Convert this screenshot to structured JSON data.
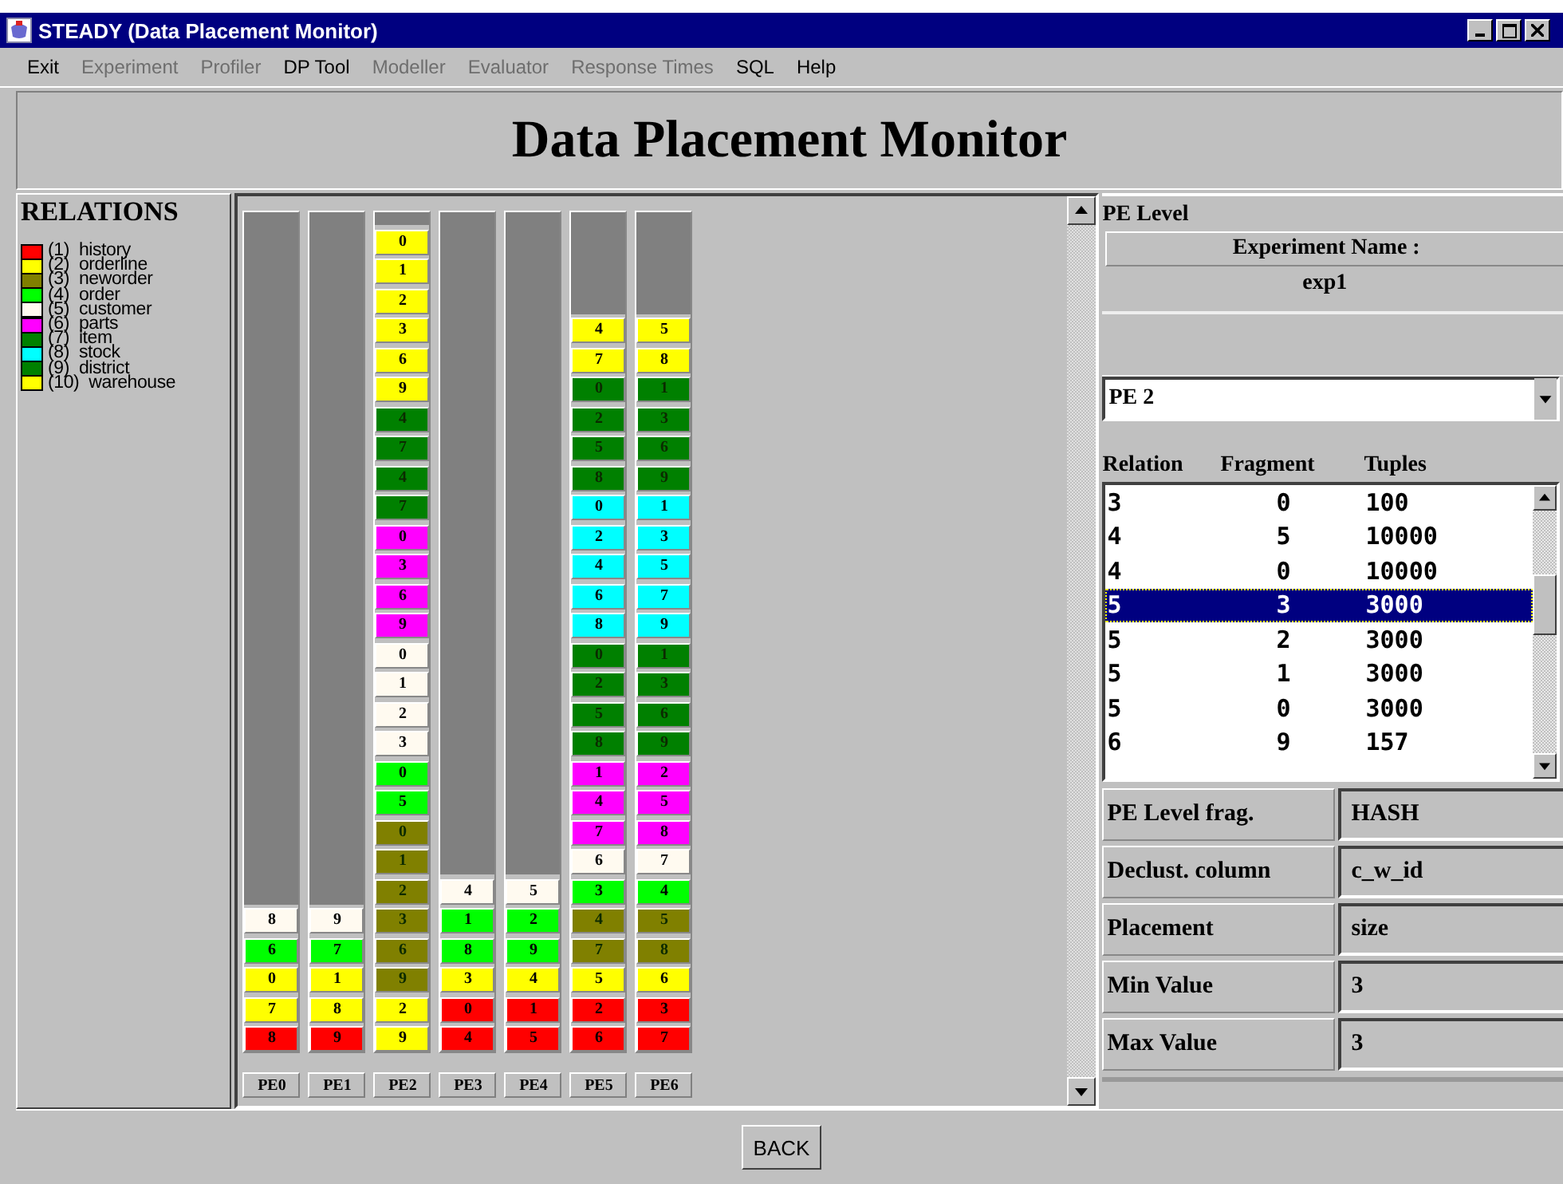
{
  "window": {
    "title": "STEADY (Data Placement Monitor)"
  },
  "menu": [
    {
      "label": "Exit",
      "disabled": false
    },
    {
      "label": "Experiment",
      "disabled": true
    },
    {
      "label": "Profiler",
      "disabled": true
    },
    {
      "label": "DP Tool",
      "disabled": false
    },
    {
      "label": "Modeller",
      "disabled": true
    },
    {
      "label": "Evaluator",
      "disabled": true
    },
    {
      "label": "Response Times",
      "disabled": true
    },
    {
      "label": "SQL",
      "disabled": false
    },
    {
      "label": "Help",
      "disabled": false
    }
  ],
  "heading": "Data Placement Monitor",
  "legend": {
    "title": "RELATIONS",
    "items": [
      {
        "label": "(1)  history",
        "color": "#ff0000"
      },
      {
        "label": "(2)  orderline",
        "color": "#ffff00"
      },
      {
        "label": "(3)  neworder",
        "color": "#808000"
      },
      {
        "label": "(4)  order",
        "color": "#00ff00"
      },
      {
        "label": "(5)  customer",
        "color": "#fffaf0"
      },
      {
        "label": "(6)  parts",
        "color": "#ff00ff"
      },
      {
        "label": "(7)  item",
        "color": "#008000"
      },
      {
        "label": "(8)  stock",
        "color": "#00ffff"
      },
      {
        "label": "(9)  district",
        "color": "#008000"
      },
      {
        "label": "(10)  warehouse",
        "color": "#ffff00"
      }
    ]
  },
  "pes": [
    {
      "label": "PE0",
      "fragments": [
        {
          "label": "8",
          "color": "#fffaf0"
        },
        {
          "label": "6",
          "color": "#00ff00"
        },
        {
          "label": "0",
          "color": "#ffff00"
        },
        {
          "label": "7",
          "color": "#ffff00"
        },
        {
          "label": "8",
          "color": "#ff0000"
        }
      ]
    },
    {
      "label": "PE1",
      "fragments": [
        {
          "label": "9",
          "color": "#fffaf0"
        },
        {
          "label": "7",
          "color": "#00ff00"
        },
        {
          "label": "1",
          "color": "#ffff00"
        },
        {
          "label": "8",
          "color": "#ffff00"
        },
        {
          "label": "9",
          "color": "#ff0000"
        }
      ]
    },
    {
      "label": "PE2",
      "fragments": [
        {
          "label": "0",
          "color": "#ffff00"
        },
        {
          "label": "1",
          "color": "#ffff00"
        },
        {
          "label": "2",
          "color": "#ffff00"
        },
        {
          "label": "3",
          "color": "#ffff00"
        },
        {
          "label": "6",
          "color": "#ffff00"
        },
        {
          "label": "9",
          "color": "#ffff00"
        },
        {
          "label": "4",
          "color": "#008000"
        },
        {
          "label": "7",
          "color": "#008000"
        },
        {
          "label": "4",
          "color": "#008000"
        },
        {
          "label": "7",
          "color": "#008000"
        },
        {
          "label": "0",
          "color": "#ff00ff"
        },
        {
          "label": "3",
          "color": "#ff00ff"
        },
        {
          "label": "6",
          "color": "#ff00ff"
        },
        {
          "label": "9",
          "color": "#ff00ff"
        },
        {
          "label": "0",
          "color": "#fffaf0"
        },
        {
          "label": "1",
          "color": "#fffaf0"
        },
        {
          "label": "2",
          "color": "#fffaf0"
        },
        {
          "label": "3",
          "color": "#fffaf0"
        },
        {
          "label": "0",
          "color": "#00ff00"
        },
        {
          "label": "5",
          "color": "#00ff00"
        },
        {
          "label": "0",
          "color": "#808000"
        },
        {
          "label": "1",
          "color": "#808000"
        },
        {
          "label": "2",
          "color": "#808000"
        },
        {
          "label": "3",
          "color": "#808000"
        },
        {
          "label": "6",
          "color": "#808000"
        },
        {
          "label": "9",
          "color": "#808000"
        },
        {
          "label": "2",
          "color": "#ffff00"
        },
        {
          "label": "9",
          "color": "#ffff00"
        }
      ]
    },
    {
      "label": "PE3",
      "fragments": [
        {
          "label": "4",
          "color": "#fffaf0"
        },
        {
          "label": "1",
          "color": "#00ff00"
        },
        {
          "label": "8",
          "color": "#00ff00"
        },
        {
          "label": "3",
          "color": "#ffff00"
        },
        {
          "label": "0",
          "color": "#ff0000"
        },
        {
          "label": "4",
          "color": "#ff0000"
        }
      ]
    },
    {
      "label": "PE4",
      "fragments": [
        {
          "label": "5",
          "color": "#fffaf0"
        },
        {
          "label": "2",
          "color": "#00ff00"
        },
        {
          "label": "9",
          "color": "#00ff00"
        },
        {
          "label": "4",
          "color": "#ffff00"
        },
        {
          "label": "1",
          "color": "#ff0000"
        },
        {
          "label": "5",
          "color": "#ff0000"
        }
      ]
    },
    {
      "label": "PE5",
      "fragments": [
        {
          "label": "4",
          "color": "#ffff00"
        },
        {
          "label": "7",
          "color": "#ffff00"
        },
        {
          "label": "0",
          "color": "#008000"
        },
        {
          "label": "2",
          "color": "#008000"
        },
        {
          "label": "5",
          "color": "#008000"
        },
        {
          "label": "8",
          "color": "#008000"
        },
        {
          "label": "0",
          "color": "#00ffff"
        },
        {
          "label": "2",
          "color": "#00ffff"
        },
        {
          "label": "4",
          "color": "#00ffff"
        },
        {
          "label": "6",
          "color": "#00ffff"
        },
        {
          "label": "8",
          "color": "#00ffff"
        },
        {
          "label": "0",
          "color": "#008000"
        },
        {
          "label": "2",
          "color": "#008000"
        },
        {
          "label": "5",
          "color": "#008000"
        },
        {
          "label": "8",
          "color": "#008000"
        },
        {
          "label": "1",
          "color": "#ff00ff"
        },
        {
          "label": "4",
          "color": "#ff00ff"
        },
        {
          "label": "7",
          "color": "#ff00ff"
        },
        {
          "label": "6",
          "color": "#fffaf0"
        },
        {
          "label": "3",
          "color": "#00ff00"
        },
        {
          "label": "4",
          "color": "#808000"
        },
        {
          "label": "7",
          "color": "#808000"
        },
        {
          "label": "5",
          "color": "#ffff00"
        },
        {
          "label": "2",
          "color": "#ff0000"
        },
        {
          "label": "6",
          "color": "#ff0000"
        }
      ]
    },
    {
      "label": "PE6",
      "fragments": [
        {
          "label": "5",
          "color": "#ffff00"
        },
        {
          "label": "8",
          "color": "#ffff00"
        },
        {
          "label": "1",
          "color": "#008000"
        },
        {
          "label": "3",
          "color": "#008000"
        },
        {
          "label": "6",
          "color": "#008000"
        },
        {
          "label": "9",
          "color": "#008000"
        },
        {
          "label": "1",
          "color": "#00ffff"
        },
        {
          "label": "3",
          "color": "#00ffff"
        },
        {
          "label": "5",
          "color": "#00ffff"
        },
        {
          "label": "7",
          "color": "#00ffff"
        },
        {
          "label": "9",
          "color": "#00ffff"
        },
        {
          "label": "1",
          "color": "#008000"
        },
        {
          "label": "3",
          "color": "#008000"
        },
        {
          "label": "6",
          "color": "#008000"
        },
        {
          "label": "9",
          "color": "#008000"
        },
        {
          "label": "2",
          "color": "#ff00ff"
        },
        {
          "label": "5",
          "color": "#ff00ff"
        },
        {
          "label": "8",
          "color": "#ff00ff"
        },
        {
          "label": "7",
          "color": "#fffaf0"
        },
        {
          "label": "4",
          "color": "#00ff00"
        },
        {
          "label": "5",
          "color": "#808000"
        },
        {
          "label": "8",
          "color": "#808000"
        },
        {
          "label": "6",
          "color": "#ffff00"
        },
        {
          "label": "3",
          "color": "#ff0000"
        },
        {
          "label": "7",
          "color": "#ff0000"
        }
      ]
    }
  ],
  "details": {
    "title": "PE Level",
    "experiment_label": "Experiment Name :",
    "experiment_name": "exp1",
    "pe_select": {
      "value": "PE 2"
    },
    "table": {
      "columns": [
        "Relation",
        "Fragment",
        "Tuples"
      ],
      "rows": [
        {
          "cells": [
            "3",
            "0",
            "100"
          ],
          "selected": false
        },
        {
          "cells": [
            "4",
            "5",
            "10000"
          ],
          "selected": false
        },
        {
          "cells": [
            "4",
            "0",
            "10000"
          ],
          "selected": false
        },
        {
          "cells": [
            "5",
            "3",
            "3000"
          ],
          "selected": true
        },
        {
          "cells": [
            "5",
            "2",
            "3000"
          ],
          "selected": false
        },
        {
          "cells": [
            "5",
            "1",
            "3000"
          ],
          "selected": false
        },
        {
          "cells": [
            "5",
            "0",
            "3000"
          ],
          "selected": false
        },
        {
          "cells": [
            "6",
            "9",
            "157"
          ],
          "selected": false
        }
      ]
    },
    "properties": [
      {
        "label": "PE Level frag.",
        "value": "HASH"
      },
      {
        "label": "Declust. column",
        "value": "c_w_id"
      },
      {
        "label": "Placement",
        "value": "size"
      },
      {
        "label": "Min Value",
        "value": "3"
      },
      {
        "label": "Max Value",
        "value": "3"
      }
    ]
  },
  "back_button": "BACK"
}
